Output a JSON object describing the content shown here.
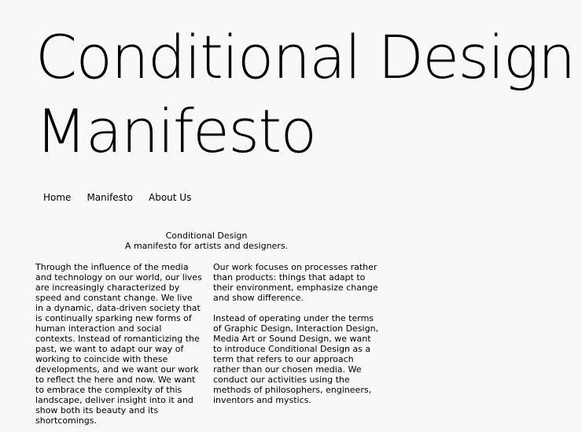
{
  "masthead": {
    "line1": "Conditional Design",
    "line2": "Manifesto"
  },
  "nav": {
    "items": [
      "Home",
      "Manifesto",
      "About Us"
    ]
  },
  "intro": {
    "title": "Conditional Design",
    "subtitle": "A manifesto for artists and designers."
  },
  "columns": {
    "left": {
      "paragraph1": "Through the influence of the media and technology on our world, our lives are increasingly characterized by speed and constant change. We live in a dynamic, data-driven society that is continually sparking new forms of human interaction and social contexts. Instead of romanticizing the past, we want to adapt our way of working to coincide with these developments, and we want our work to reflect the here and now. We want to embrace the complexity of this landscape, deliver insight into it and show both its beauty and its shortcomings."
    },
    "right": {
      "paragraph1": "Our work focuses on processes rather than products: things that adapt to their environment, emphasize change and show difference.",
      "paragraph2": "Instead of operating under the terms of Graphic Design, Interaction Design, Media Art or Sound Design, we want to introduce Conditional Design as a term that refers to our approach rather than our chosen media. We conduct our activities using the methods of philosophers, engineers, inventors and mystics."
    }
  }
}
